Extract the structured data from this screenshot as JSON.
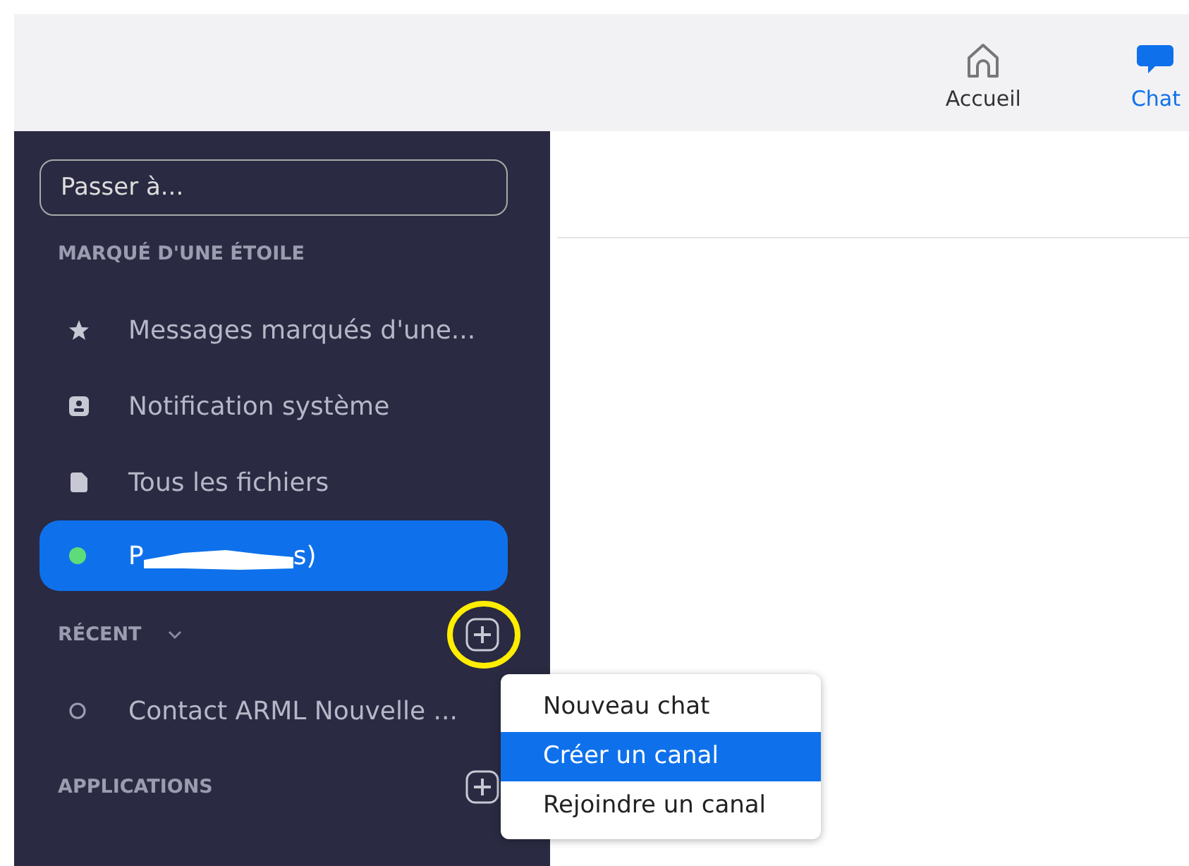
{
  "top_nav": [
    {
      "label": "Accueil",
      "selected": false
    },
    {
      "label": "Chat",
      "selected": true
    }
  ],
  "sidebar": {
    "search": {
      "placeholder": "Passer à..."
    },
    "sections": [
      {
        "title": "MARQUÉ D'UNE ÉTOILE",
        "collapsible": false,
        "add_button": false,
        "items": [
          {
            "kind": "star",
            "label": "Messages marqués d'une...",
            "selected": false
          },
          {
            "kind": "contact-card",
            "label": "Notification système",
            "selected": false
          },
          {
            "kind": "file",
            "label": "Tous les fichiers",
            "selected": false
          },
          {
            "kind": "presence",
            "label_start": "P",
            "label_end": "s)",
            "redacted": true,
            "online": true,
            "selected": true
          }
        ]
      },
      {
        "title": "RÉCENT",
        "collapsible": true,
        "add_button": true,
        "highlighted": true,
        "items": [
          {
            "kind": "presence",
            "label": "Contact  ARML Nouvelle ...",
            "online": false,
            "selected": false
          }
        ]
      },
      {
        "title": "APPLICATIONS",
        "collapsible": false,
        "add_button": true,
        "highlighted": false
      }
    ]
  },
  "context_menu": {
    "items": [
      {
        "label": "Nouveau chat",
        "selected": false
      },
      {
        "label": "Créer un canal",
        "selected": true
      },
      {
        "label": "Rejoindre un canal",
        "selected": false
      }
    ]
  }
}
